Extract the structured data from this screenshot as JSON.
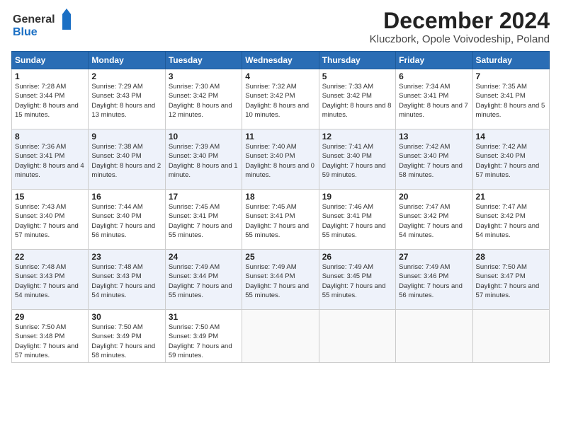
{
  "header": {
    "logo_line1": "General",
    "logo_line2": "Blue",
    "main_title": "December 2024",
    "subtitle": "Kluczbork, Opole Voivodeship, Poland"
  },
  "days_of_week": [
    "Sunday",
    "Monday",
    "Tuesday",
    "Wednesday",
    "Thursday",
    "Friday",
    "Saturday"
  ],
  "weeks": [
    [
      {
        "day": "1",
        "sunrise": "Sunrise: 7:28 AM",
        "sunset": "Sunset: 3:44 PM",
        "daylight": "Daylight: 8 hours and 15 minutes."
      },
      {
        "day": "2",
        "sunrise": "Sunrise: 7:29 AM",
        "sunset": "Sunset: 3:43 PM",
        "daylight": "Daylight: 8 hours and 13 minutes."
      },
      {
        "day": "3",
        "sunrise": "Sunrise: 7:30 AM",
        "sunset": "Sunset: 3:42 PM",
        "daylight": "Daylight: 8 hours and 12 minutes."
      },
      {
        "day": "4",
        "sunrise": "Sunrise: 7:32 AM",
        "sunset": "Sunset: 3:42 PM",
        "daylight": "Daylight: 8 hours and 10 minutes."
      },
      {
        "day": "5",
        "sunrise": "Sunrise: 7:33 AM",
        "sunset": "Sunset: 3:42 PM",
        "daylight": "Daylight: 8 hours and 8 minutes."
      },
      {
        "day": "6",
        "sunrise": "Sunrise: 7:34 AM",
        "sunset": "Sunset: 3:41 PM",
        "daylight": "Daylight: 8 hours and 7 minutes."
      },
      {
        "day": "7",
        "sunrise": "Sunrise: 7:35 AM",
        "sunset": "Sunset: 3:41 PM",
        "daylight": "Daylight: 8 hours and 5 minutes."
      }
    ],
    [
      {
        "day": "8",
        "sunrise": "Sunrise: 7:36 AM",
        "sunset": "Sunset: 3:41 PM",
        "daylight": "Daylight: 8 hours and 4 minutes."
      },
      {
        "day": "9",
        "sunrise": "Sunrise: 7:38 AM",
        "sunset": "Sunset: 3:40 PM",
        "daylight": "Daylight: 8 hours and 2 minutes."
      },
      {
        "day": "10",
        "sunrise": "Sunrise: 7:39 AM",
        "sunset": "Sunset: 3:40 PM",
        "daylight": "Daylight: 8 hours and 1 minute."
      },
      {
        "day": "11",
        "sunrise": "Sunrise: 7:40 AM",
        "sunset": "Sunset: 3:40 PM",
        "daylight": "Daylight: 8 hours and 0 minutes."
      },
      {
        "day": "12",
        "sunrise": "Sunrise: 7:41 AM",
        "sunset": "Sunset: 3:40 PM",
        "daylight": "Daylight: 7 hours and 59 minutes."
      },
      {
        "day": "13",
        "sunrise": "Sunrise: 7:42 AM",
        "sunset": "Sunset: 3:40 PM",
        "daylight": "Daylight: 7 hours and 58 minutes."
      },
      {
        "day": "14",
        "sunrise": "Sunrise: 7:42 AM",
        "sunset": "Sunset: 3:40 PM",
        "daylight": "Daylight: 7 hours and 57 minutes."
      }
    ],
    [
      {
        "day": "15",
        "sunrise": "Sunrise: 7:43 AM",
        "sunset": "Sunset: 3:40 PM",
        "daylight": "Daylight: 7 hours and 57 minutes."
      },
      {
        "day": "16",
        "sunrise": "Sunrise: 7:44 AM",
        "sunset": "Sunset: 3:40 PM",
        "daylight": "Daylight: 7 hours and 56 minutes."
      },
      {
        "day": "17",
        "sunrise": "Sunrise: 7:45 AM",
        "sunset": "Sunset: 3:41 PM",
        "daylight": "Daylight: 7 hours and 55 minutes."
      },
      {
        "day": "18",
        "sunrise": "Sunrise: 7:45 AM",
        "sunset": "Sunset: 3:41 PM",
        "daylight": "Daylight: 7 hours and 55 minutes."
      },
      {
        "day": "19",
        "sunrise": "Sunrise: 7:46 AM",
        "sunset": "Sunset: 3:41 PM",
        "daylight": "Daylight: 7 hours and 55 minutes."
      },
      {
        "day": "20",
        "sunrise": "Sunrise: 7:47 AM",
        "sunset": "Sunset: 3:42 PM",
        "daylight": "Daylight: 7 hours and 54 minutes."
      },
      {
        "day": "21",
        "sunrise": "Sunrise: 7:47 AM",
        "sunset": "Sunset: 3:42 PM",
        "daylight": "Daylight: 7 hours and 54 minutes."
      }
    ],
    [
      {
        "day": "22",
        "sunrise": "Sunrise: 7:48 AM",
        "sunset": "Sunset: 3:43 PM",
        "daylight": "Daylight: 7 hours and 54 minutes."
      },
      {
        "day": "23",
        "sunrise": "Sunrise: 7:48 AM",
        "sunset": "Sunset: 3:43 PM",
        "daylight": "Daylight: 7 hours and 54 minutes."
      },
      {
        "day": "24",
        "sunrise": "Sunrise: 7:49 AM",
        "sunset": "Sunset: 3:44 PM",
        "daylight": "Daylight: 7 hours and 55 minutes."
      },
      {
        "day": "25",
        "sunrise": "Sunrise: 7:49 AM",
        "sunset": "Sunset: 3:44 PM",
        "daylight": "Daylight: 7 hours and 55 minutes."
      },
      {
        "day": "26",
        "sunrise": "Sunrise: 7:49 AM",
        "sunset": "Sunset: 3:45 PM",
        "daylight": "Daylight: 7 hours and 55 minutes."
      },
      {
        "day": "27",
        "sunrise": "Sunrise: 7:49 AM",
        "sunset": "Sunset: 3:46 PM",
        "daylight": "Daylight: 7 hours and 56 minutes."
      },
      {
        "day": "28",
        "sunrise": "Sunrise: 7:50 AM",
        "sunset": "Sunset: 3:47 PM",
        "daylight": "Daylight: 7 hours and 57 minutes."
      }
    ],
    [
      {
        "day": "29",
        "sunrise": "Sunrise: 7:50 AM",
        "sunset": "Sunset: 3:48 PM",
        "daylight": "Daylight: 7 hours and 57 minutes."
      },
      {
        "day": "30",
        "sunrise": "Sunrise: 7:50 AM",
        "sunset": "Sunset: 3:49 PM",
        "daylight": "Daylight: 7 hours and 58 minutes."
      },
      {
        "day": "31",
        "sunrise": "Sunrise: 7:50 AM",
        "sunset": "Sunset: 3:49 PM",
        "daylight": "Daylight: 7 hours and 59 minutes."
      },
      null,
      null,
      null,
      null
    ]
  ]
}
